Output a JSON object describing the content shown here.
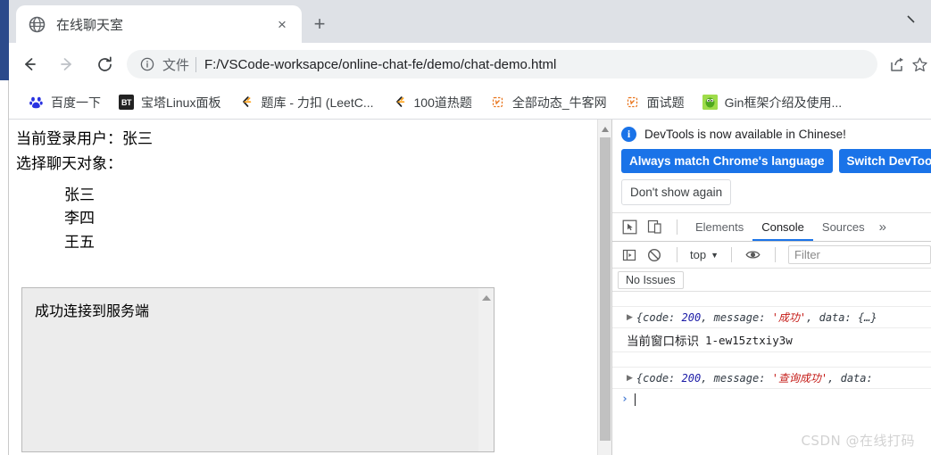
{
  "browser": {
    "tab": {
      "title": "在线聊天室",
      "favicon": "globe-icon",
      "close_label": "×"
    },
    "new_tab_label": "+",
    "nav": {
      "back": "←",
      "forward": "→",
      "reload": "⟳"
    },
    "omnibox": {
      "info_icon": "info-circle-icon",
      "scheme_label": "文件",
      "url": "F:/VSCode-worksapce/online-chat-fe/demo/chat-demo.html",
      "share_icon": "share-icon",
      "bookmark_icon": "star-icon"
    },
    "bookmarks": [
      {
        "icon": "baidu-icon",
        "label": "百度一下"
      },
      {
        "icon": "bt-panel-icon",
        "label": "宝塔Linux面板"
      },
      {
        "icon": "leetcode-icon",
        "label": "题库 - 力扣 (LeetC..."
      },
      {
        "icon": "leetcode-icon",
        "label": "100道热题"
      },
      {
        "icon": "nowcoder-icon",
        "label": "全部动态_牛客网"
      },
      {
        "icon": "nowcoder-icon",
        "label": "面试题"
      },
      {
        "icon": "gin-icon",
        "label": "Gin框架介绍及使用..."
      }
    ]
  },
  "page": {
    "current_user_line": "当前登录用户：张三",
    "select_target_line": "选择聊天对象：",
    "users": [
      "张三",
      "李四",
      "王五"
    ],
    "chat_log": [
      "成功连接到服务端"
    ]
  },
  "devtools": {
    "notice": {
      "icon": "info-circle-icon",
      "text": "DevTools is now available in Chinese!",
      "primary_buttons": [
        "Always match Chrome's language",
        "Switch DevTools to Chinese"
      ],
      "secondary_button": "Don't show again"
    },
    "toolbar_icons": [
      "inspect-element-icon",
      "device-toolbar-icon"
    ],
    "tabs": [
      {
        "label": "Elements",
        "active": false
      },
      {
        "label": "Console",
        "active": true
      },
      {
        "label": "Sources",
        "active": false
      }
    ],
    "more_tabs_label": "»",
    "console_bar": {
      "sidebar_icon": "console-sidebar-icon",
      "clear_icon": "clear-console-icon",
      "context": "top",
      "context_caret": "▼",
      "eye_icon": "live-expression-icon",
      "filter_placeholder": "Filter"
    },
    "issues_button": "No Issues",
    "logs": [
      {
        "type": "object",
        "arrow": "▶",
        "code_key": "code:",
        "code_value": "200",
        "message_key": "message:",
        "message_value": "'成功'",
        "tail": ", data: {…}"
      },
      {
        "type": "text",
        "cn": "当前窗口标识",
        "mono": "1-ew15ztxiy3w"
      },
      {
        "type": "object",
        "arrow": "▶",
        "code_key": "code:",
        "code_value": "200",
        "message_key": "message:",
        "message_value": "'查询成功'",
        "tail": ", data:"
      }
    ],
    "prompt_caret": "›",
    "watermark": "CSDN @在线打码"
  },
  "colors": {
    "accent_blue": "#1a73e8",
    "tabstrip_bg": "#dee1e6",
    "frame_blue": "#2b4a8b",
    "chatbox_bg": "#ececec"
  }
}
